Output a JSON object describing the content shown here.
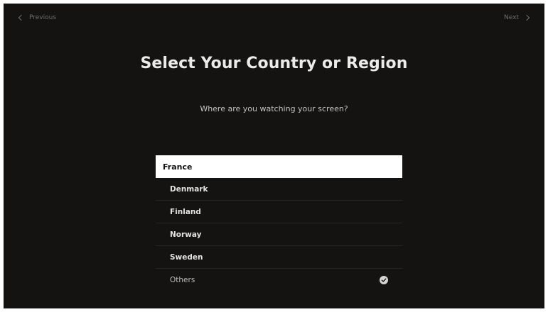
{
  "nav": {
    "previous_label": "Previous",
    "next_label": "Next"
  },
  "heading": {
    "title": "Select Your Country or Region",
    "subtitle": "Where are you watching your screen?"
  },
  "countries": [
    {
      "label": "France",
      "state": "focused"
    },
    {
      "label": "Denmark",
      "state": "normal"
    },
    {
      "label": "Finland",
      "state": "normal"
    },
    {
      "label": "Norway",
      "state": "normal"
    },
    {
      "label": "Sweden",
      "state": "normal"
    },
    {
      "label": "Others",
      "state": "checked",
      "icon": "checkmark-circle-icon"
    }
  ],
  "colors": {
    "background": "#141312",
    "focus_row": "#ffffff",
    "text": "#e4e2de",
    "muted": "#6f6d69"
  }
}
